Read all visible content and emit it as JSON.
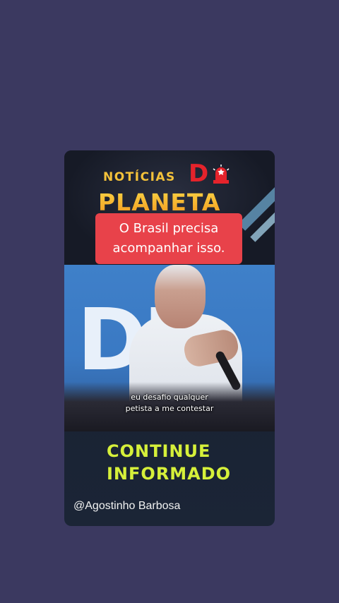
{
  "card": {
    "brand_top": "NOTÍCIAS",
    "brand_letter": "D",
    "brand_main": "PLANETA",
    "headline_line1": "O Brasil precisa",
    "headline_line2": "acompanhar isso.",
    "video": {
      "subtitle_line1": "eu desafio qualquer",
      "subtitle_line2": "petista a me contestar"
    },
    "cta_line1": "CONTINUE",
    "cta_line2": "INFORMADO",
    "handle": "@Agostinho Barbosa"
  },
  "colors": {
    "background": "#3b3960",
    "brand_top": "#f4c23a",
    "brand_letter": "#e5232b",
    "headline_bg": "#e8424a",
    "cta": "#d6f03a"
  },
  "icons": {
    "siren": "siren-icon"
  }
}
